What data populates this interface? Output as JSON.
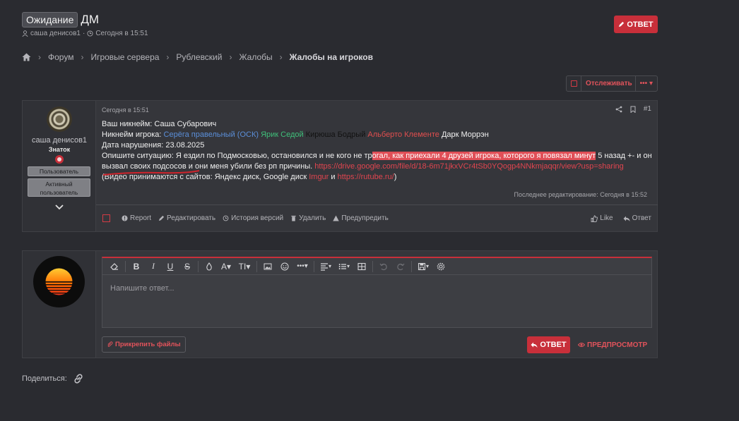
{
  "thread": {
    "prefix": "Ожидание",
    "title": "ДМ",
    "author": "саша денисов1",
    "meta_sep": "·",
    "date": "Сегодня в 15:51",
    "reply_label": "ОТВЕТ"
  },
  "breadcrumb": {
    "items": [
      "Форум",
      "Игровые сервера",
      "Рублевский",
      "Жалобы"
    ],
    "current": "Жалобы на игроков"
  },
  "watch": {
    "label": "Отслеживать",
    "more": "•••"
  },
  "post": {
    "username": "саша денисов1",
    "user_title": "Знаток",
    "banners": [
      "Пользователь",
      "Активный пользователь"
    ],
    "date": "Сегодня в 15:51",
    "number": "#1",
    "lines": {
      "l1": "Ваш никнейм: Саша Субарович",
      "l2_label": "Никнейм игрока: ",
      "n1": "Серёга правельный (ОСК)",
      "n2": "Ярик Седой",
      "n3": "Кирюша Бодрый",
      "n4": "Альберто Клементе",
      "n5": "Дарк Моррэн",
      "l3": "Дата нарушения: 23.08.2025",
      "l4a": "Опишите ситуацию: Я ездил по Подмосковью, остановился и не кого не тр",
      "l4hl": "огал, как приехали 4 друзей игрока, которого я повязал минут",
      "l4b": " 5 назад +- и он",
      "l5a": "вызвал своих подсосов и они меня убили без рп причины. ",
      "l5link": "https://drive.google.com/file/d/18-6m71jkxVCr4tSb0YQogp4NNkmjaqqr/view?usp=sharing",
      "l6a": "(Видео принимаются с сайтов: Яндекс диск, Google диск ",
      "l6imgur": "Imgur",
      "l6and": " и ",
      "l6rutube": "https://rutube.ru/",
      "l6end": ")"
    },
    "last_edit": "Последнее редактирование: Сегодня в 15:52",
    "actions": {
      "report": "Report",
      "edit": "Редактировать",
      "history": "История версий",
      "delete": "Удалить",
      "warn": "Предупредить",
      "like": "Like",
      "reply": "Ответ"
    }
  },
  "reply_box": {
    "placeholder": "Напишите ответ...",
    "attach": "Прикрепить файлы",
    "send": "ОТВЕТ",
    "preview": "ПРЕДПРОСМОТР"
  },
  "share": {
    "label": "Поделиться:"
  },
  "colors": {
    "accent": "#c82f3a",
    "background": "#2a2b30",
    "panel": "#35363b"
  }
}
